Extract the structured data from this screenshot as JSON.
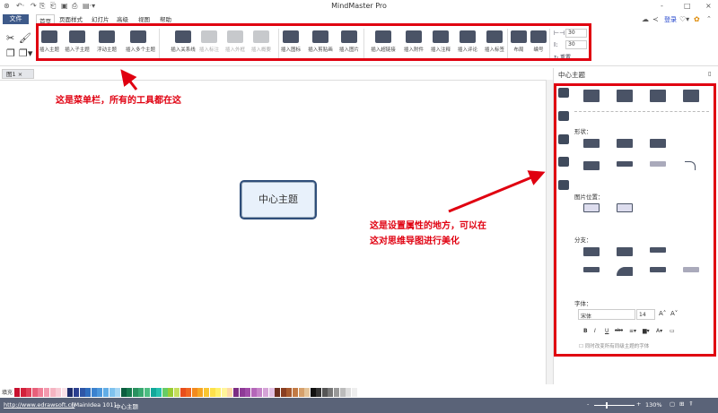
{
  "window": {
    "title": "MindMaster Pro",
    "minimize": "-",
    "maximize": "□",
    "close": "×"
  },
  "menu_tabs": [
    "文件",
    "首页",
    "页面样式",
    "幻灯片",
    "高级",
    "视图",
    "帮助"
  ],
  "header_right": {
    "login": "登录"
  },
  "ribbon": {
    "items": [
      {
        "label": "插入主题",
        "disabled": false
      },
      {
        "label": "插入子主题",
        "disabled": false
      },
      {
        "label": "浮动主题",
        "disabled": false
      },
      {
        "label": "插入多个主题",
        "disabled": false
      },
      {
        "label": "插入关系线",
        "disabled": false
      },
      {
        "label": "插入标注",
        "disabled": true
      },
      {
        "label": "插入外框",
        "disabled": true
      },
      {
        "label": "插入概要",
        "disabled": true
      },
      {
        "label": "插入图标",
        "disabled": false
      },
      {
        "label": "插入剪贴画",
        "disabled": false
      },
      {
        "label": "插入图片",
        "disabled": false
      },
      {
        "label": "插入超链接",
        "disabled": false
      },
      {
        "label": "插入附件",
        "disabled": false
      },
      {
        "label": "插入注释",
        "disabled": false
      },
      {
        "label": "插入评论",
        "disabled": false
      },
      {
        "label": "插入标签",
        "disabled": false
      },
      {
        "label": "布局",
        "disabled": false
      },
      {
        "label": "编号",
        "disabled": false
      }
    ],
    "spacing_h": "30",
    "spacing_v": "30",
    "reset": "重置"
  },
  "document_tab": {
    "label": "图1",
    "close": "×"
  },
  "canvas": {
    "central_topic": "中心主题"
  },
  "annotations": {
    "menu_note": "这是菜单栏，所有的工具都在这",
    "panel_note_line1": "这是设置属性的地方，可以在",
    "panel_note_line2": "这对思维导图进行美化",
    "color": "#e00010"
  },
  "panel": {
    "title": "中心主题",
    "shape_label": "形状：",
    "image_pos_label": "图片位置：",
    "branch_label": "分支：",
    "font_label": "字体：",
    "font_family": "宋体",
    "font_size": "14",
    "font_grow": "A˄",
    "font_shrink": "A˅",
    "bold": "B",
    "italic": "I",
    "underline": "U",
    "strike": "abc",
    "apply_all_label": "同时改变所有同级主题的字体"
  },
  "palette": {
    "label": "填充",
    "colors": [
      "#c8102e",
      "#d3213b",
      "#e04058",
      "#e8607a",
      "#f08098",
      "#f39aaf",
      "#f5b4c2",
      "#f8ccd6",
      "#fbe2e8",
      "#1f2d6b",
      "#2b3f8f",
      "#2e56a6",
      "#2f6dbd",
      "#3b82cf",
      "#4d98dc",
      "#62ade6",
      "#7fc2ee",
      "#a6d6f4",
      "#0b5e3f",
      "#177a4e",
      "#2a9160",
      "#38a870",
      "#4dbd82",
      "#12a89a",
      "#25c0ae",
      "#66cc66",
      "#99cc33",
      "#c6de5e",
      "#e84e1b",
      "#f06522",
      "#f38a1e",
      "#f6a623",
      "#f9c531",
      "#fde14a",
      "#fff06a",
      "#fff59a",
      "#fdd9a8",
      "#7b2d83",
      "#8e3a97",
      "#a04ca8",
      "#b466b9",
      "#c684c9",
      "#d5a3d7",
      "#e2c0e3",
      "#6b2e1f",
      "#8a3f22",
      "#a85a2e",
      "#c27a44",
      "#d6a06b",
      "#e4c49a",
      "#111111",
      "#333333",
      "#555555",
      "#777777",
      "#999999",
      "#bbbbbb",
      "#dddddd",
      "#eeeeee"
    ]
  },
  "status": {
    "url": "http://www.edrawsoft.cn",
    "info": "[MainIdea 101]",
    "topic": "中心主题",
    "zoom": "130%",
    "minus": "-",
    "plus": "+"
  }
}
